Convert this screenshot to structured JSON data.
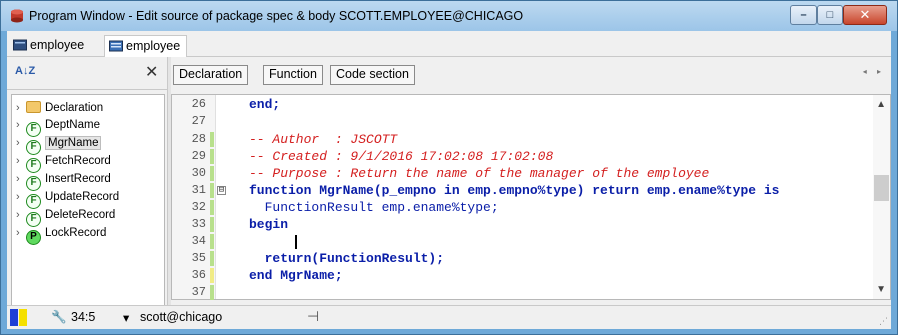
{
  "window": {
    "title": "Program Window - Edit source of package spec & body SCOTT.EMPLOYEE@CHICAGO",
    "minimize": "–",
    "maximize": "□",
    "close": "✕"
  },
  "tabs": [
    {
      "label": "employee",
      "icon": "package-spec-icon"
    },
    {
      "label": "employee",
      "icon": "package-body-icon"
    }
  ],
  "left_pane": {
    "sort_icon": "A↓Z",
    "close": "✕",
    "tree": [
      {
        "label": "Declaration",
        "badge": ""
      },
      {
        "label": "DeptName",
        "badge": "F"
      },
      {
        "label": "MgrName",
        "badge": "F"
      },
      {
        "label": "FetchRecord",
        "badge": "F"
      },
      {
        "label": "InsertRecord",
        "badge": "F"
      },
      {
        "label": "UpdateRecord",
        "badge": "F"
      },
      {
        "label": "DeleteRecord",
        "badge": "F"
      },
      {
        "label": "LockRecord",
        "badge": "P"
      }
    ]
  },
  "section_buttons": [
    "Declaration",
    "Function",
    "Code section"
  ],
  "nav_arrows": "◂ ▸",
  "editor": {
    "fold_glyph": "⊟",
    "lines": [
      {
        "n": "26",
        "text": "end;"
      },
      {
        "n": "27",
        "text": ""
      },
      {
        "n": "28",
        "text": "-- Author  : JSCOTT"
      },
      {
        "n": "29",
        "text": "-- Created : 9/1/2016 17:02:08 17:02:08"
      },
      {
        "n": "30",
        "text": "-- Purpose : Return the name of the manager of the employee"
      },
      {
        "n": "31",
        "text": "function MgrName(p_empno in emp.empno%type) return emp.ename%type is"
      },
      {
        "n": "32",
        "text": "  FunctionResult emp.ename%type;"
      },
      {
        "n": "33",
        "text": "begin"
      },
      {
        "n": "34",
        "text": ""
      },
      {
        "n": "35",
        "text": "  return(FunctionResult);"
      },
      {
        "n": "36",
        "text": "end MgrName;"
      },
      {
        "n": "37",
        "text": ""
      }
    ],
    "scroll_up": "▲",
    "scroll_down": "▼"
  },
  "status": {
    "colors": [
      "#1d3fd6",
      "#f5e000"
    ],
    "position": "34:5",
    "connection": "scott@chicago",
    "pin": "⊣"
  },
  "colors": {
    "keyword": "#0a1ea8",
    "comment": "#d42020",
    "changed_saved": "#b8e08c",
    "changed_unsaved": "#f1ec86"
  }
}
